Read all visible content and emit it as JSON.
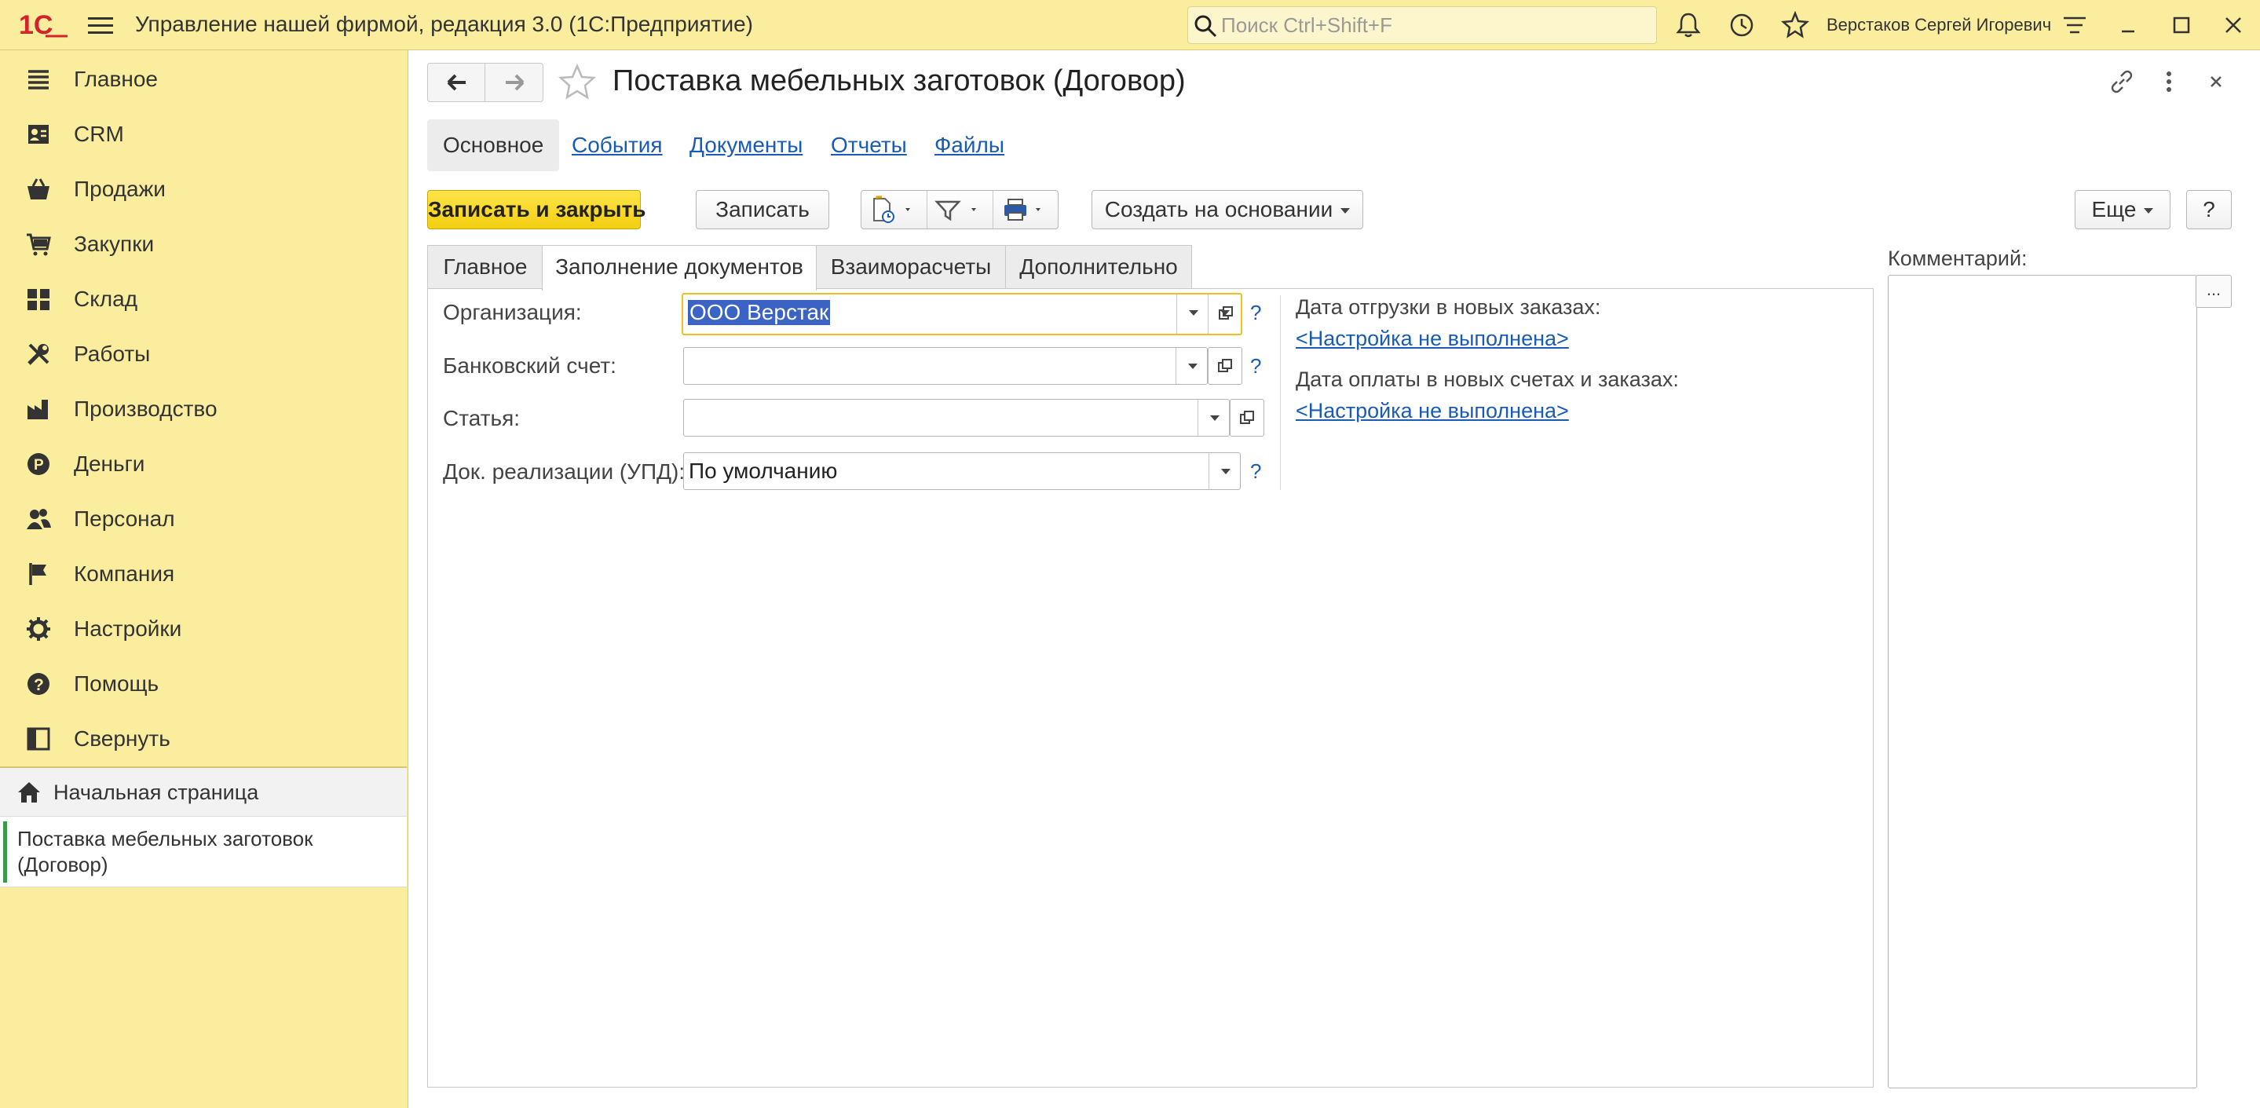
{
  "window": {
    "title": "Управление нашей фирмой, редакция 3.0  (1С:Предприятие)",
    "search_placeholder": "Поиск Ctrl+Shift+F",
    "user_name": "Верстаков Сергей Игоревич"
  },
  "sidebar": {
    "items": [
      {
        "label": "Главное",
        "icon": "list-icon"
      },
      {
        "label": "CRM",
        "icon": "contacts-card-icon"
      },
      {
        "label": "Продажи",
        "icon": "basket-icon"
      },
      {
        "label": "Закупки",
        "icon": "cart-icon"
      },
      {
        "label": "Склад",
        "icon": "warehouse-icon"
      },
      {
        "label": "Работы",
        "icon": "tools-icon"
      },
      {
        "label": "Производство",
        "icon": "factory-icon"
      },
      {
        "label": "Деньги",
        "icon": "coin-icon"
      },
      {
        "label": "Персонал",
        "icon": "people-icon"
      },
      {
        "label": "Компания",
        "icon": "flag-icon"
      },
      {
        "label": "Настройки",
        "icon": "gear-icon"
      },
      {
        "label": "Помощь",
        "icon": "help-icon"
      },
      {
        "label": "Свернуть",
        "icon": "collapse-icon"
      }
    ],
    "home_label": "Начальная страница",
    "open_window_label": "Поставка мебельных заготовок (Договор)"
  },
  "form": {
    "title": "Поставка мебельных заготовок (Договор)",
    "link_tabs": [
      "Основное",
      "События",
      "Документы",
      "Отчеты",
      "Файлы"
    ],
    "toolbar": {
      "save_close": "Записать и закрыть",
      "save": "Записать",
      "create_based": "Создать на основании",
      "more": "Еще",
      "help": "?"
    },
    "tabs": [
      "Главное",
      "Заполнение документов",
      "Взаиморасчеты",
      "Дополнительно"
    ],
    "fields": {
      "org_label": "Организация:",
      "org_value": "ООО Верстак",
      "bank_label": "Банковский счет:",
      "bank_value": "",
      "article_label": "Статья:",
      "article_value": "",
      "doc_label": "Док. реализации (УПД):",
      "doc_value": "По умолчанию"
    },
    "right": {
      "ship_label": "Дата отгрузки в новых заказах:",
      "ship_link": "<Настройка не выполнена>",
      "pay_label": "Дата оплаты в новых счетах и заказах:",
      "pay_link": "<Настройка не выполнена>"
    },
    "comment_label": "Комментарий:",
    "comment_button": "..."
  },
  "colors": {
    "sidebar_bg": "#fbed9e",
    "primary_button": "#f7d51d",
    "link": "#1a5cb5",
    "active_marker": "#3a9a4a"
  }
}
